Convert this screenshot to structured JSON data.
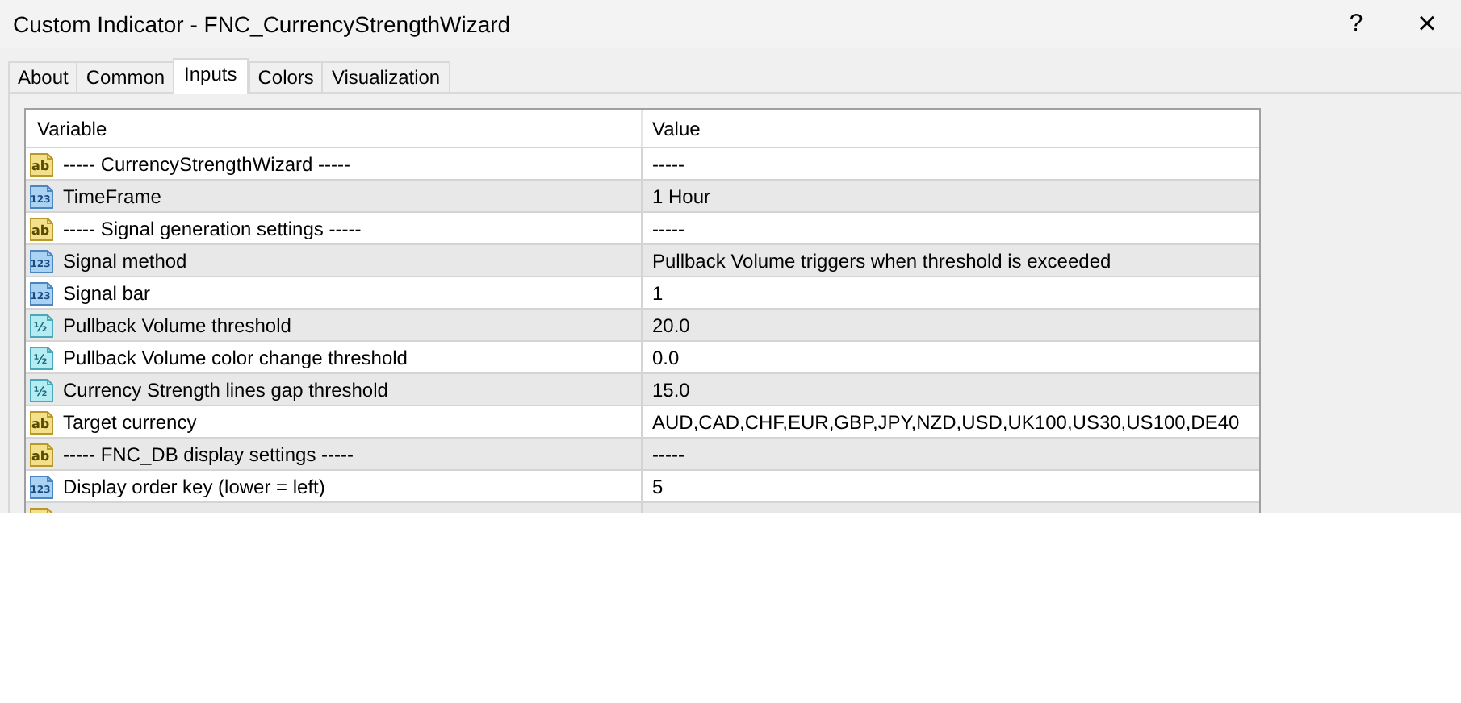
{
  "window": {
    "title": "Custom Indicator - FNC_CurrencyStrengthWizard",
    "help": "?",
    "close": "×"
  },
  "tabs": [
    {
      "label": "About",
      "selected": false
    },
    {
      "label": "Common",
      "selected": false
    },
    {
      "label": "Inputs",
      "selected": true
    },
    {
      "label": "Colors",
      "selected": false
    },
    {
      "label": "Visualization",
      "selected": false
    }
  ],
  "table": {
    "columns": [
      "Variable",
      "Value"
    ],
    "rows": [
      {
        "kind": "string",
        "icon": "ab",
        "variable": "----- CurrencyStrengthWizard -----",
        "value": "-----"
      },
      {
        "kind": "integer",
        "icon": "123",
        "variable": "TimeFrame",
        "value": "1 Hour"
      },
      {
        "kind": "string",
        "icon": "ab",
        "variable": "----- Signal generation settings -----",
        "value": "-----"
      },
      {
        "kind": "integer",
        "icon": "123",
        "variable": "Signal method",
        "value": "Pullback Volume triggers when threshold is exceeded"
      },
      {
        "kind": "integer",
        "icon": "123",
        "variable": "Signal bar",
        "value": "1"
      },
      {
        "kind": "double",
        "icon": "½",
        "variable": "Pullback Volume threshold",
        "value": "20.0"
      },
      {
        "kind": "double",
        "icon": "½",
        "variable": "Pullback Volume color change threshold",
        "value": "0.0"
      },
      {
        "kind": "double",
        "icon": "½",
        "variable": "Currency Strength lines gap threshold",
        "value": "15.0"
      },
      {
        "kind": "string",
        "icon": "ab",
        "variable": "Target currency",
        "value": "AUD,CAD,CHF,EUR,GBP,JPY,NZD,USD,UK100,US30,US100,DE40"
      },
      {
        "kind": "string",
        "icon": "ab",
        "variable": "----- FNC_DB display settings -----",
        "value": "-----"
      },
      {
        "kind": "integer",
        "icon": "123",
        "variable": "Display order key (lower = left)",
        "value": "5"
      },
      {
        "kind": "string"
      }
    ]
  }
}
